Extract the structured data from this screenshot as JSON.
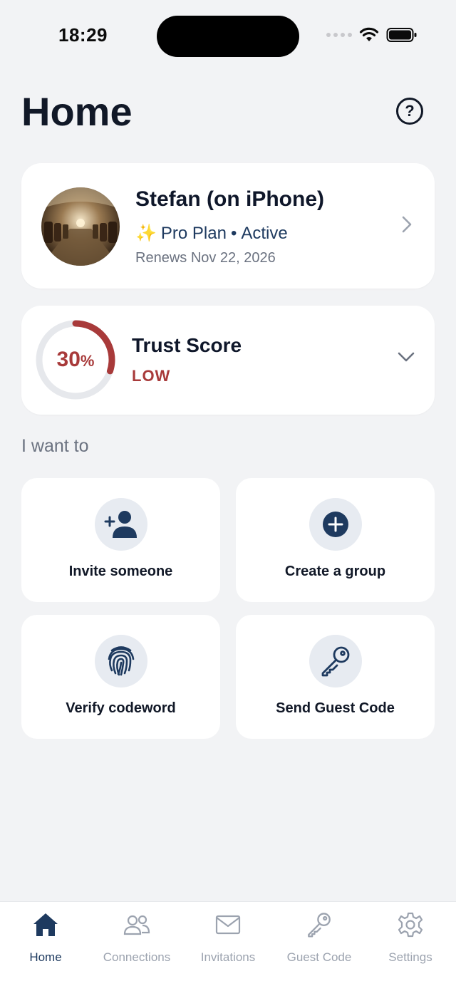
{
  "status_bar": {
    "time": "18:29"
  },
  "header": {
    "title": "Home",
    "help_symbol": "?"
  },
  "profile": {
    "name": "Stefan (on iPhone)",
    "plan_icon": "✨",
    "plan": "Pro Plan",
    "separator": "•",
    "status": "Active",
    "renews": "Renews Nov 22, 2026"
  },
  "trust": {
    "percent_value": "30",
    "percent_sign": "%",
    "fraction": 0.3,
    "title": "Trust Score",
    "level": "LOW",
    "accent_color": "#a83a3a"
  },
  "section": {
    "label": "I want to"
  },
  "actions": [
    {
      "label": "Invite someone",
      "icon": "add-person-icon"
    },
    {
      "label": "Create a group",
      "icon": "plus-circle-icon"
    },
    {
      "label": "Verify codeword",
      "icon": "fingerprint-icon"
    },
    {
      "label": "Send Guest Code",
      "icon": "key-icon"
    }
  ],
  "tabs": [
    {
      "label": "Home",
      "icon": "home-icon",
      "active": true
    },
    {
      "label": "Connections",
      "icon": "people-icon",
      "active": false
    },
    {
      "label": "Invitations",
      "icon": "envelope-icon",
      "active": false
    },
    {
      "label": "Guest Code",
      "icon": "key-icon",
      "active": false
    },
    {
      "label": "Settings",
      "icon": "gear-icon",
      "active": false
    }
  ],
  "colors": {
    "navy": "#1e3a5f",
    "inactive": "#9ca3af",
    "background": "#f2f3f5"
  }
}
